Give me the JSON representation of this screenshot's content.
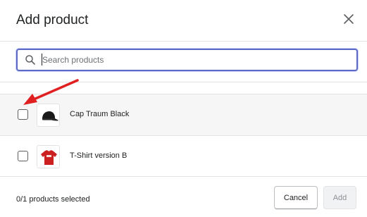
{
  "modal": {
    "title": "Add product"
  },
  "search": {
    "placeholder": "Search products",
    "value": ""
  },
  "products": [
    {
      "name": "Cap Traum Black",
      "selected": false,
      "thumbnail_icon": "black-cap-icon"
    },
    {
      "name": "T-Shirt version B",
      "selected": false,
      "thumbnail_icon": "red-tshirt-icon"
    }
  ],
  "footer": {
    "selection_status": "0/1 products selected",
    "cancel_label": "Cancel",
    "add_label": "Add"
  },
  "colors": {
    "focus_ring": "#5c6ac4",
    "annotation_arrow": "#e02020",
    "tshirt": "#cc1f1f",
    "cap": "#1a1a1a"
  }
}
